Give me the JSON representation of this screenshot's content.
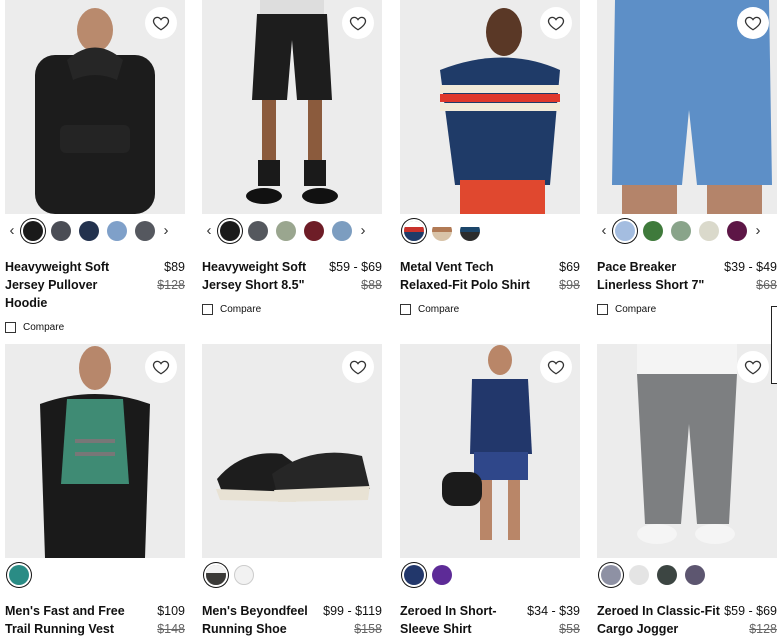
{
  "compare_label": "Compare",
  "colors": {
    "heart": "#333333",
    "text": "#111111",
    "strike": "#666666"
  },
  "products": [
    {
      "name": "Heavyweight Soft Jersey Pullover Hoodie",
      "price": "$89",
      "was": "$128",
      "swatches": [
        "#1a1a1a",
        "#4a4d55",
        "#23324e",
        "#7fa0c9",
        "#55585f"
      ],
      "has_arrows": true
    },
    {
      "name": "Heavyweight Soft Jersey Short 8.5\"",
      "price": "$59 - $69",
      "was": "$88",
      "swatches": [
        "#1a1a1a",
        "#55585e",
        "#9aa68f",
        "#6e1d27",
        "#7c9dc0"
      ],
      "has_arrows": true
    },
    {
      "name": "Metal Vent Tech Relaxed-Fit Polo Shirt",
      "price": "$69",
      "was": "$98",
      "swatches": [
        "#1f3b68",
        "#d8c3a8",
        "#1c466a"
      ],
      "has_arrows": false
    },
    {
      "name": "Pace Breaker Linerless Short 7\"",
      "price": "$39 - $49",
      "was": "$68",
      "swatches": [
        "#a4bde0",
        "#3f7a3b",
        "#89a48a",
        "#dad9cb",
        "#5d1646"
      ],
      "has_arrows": true
    },
    {
      "name": "Men's Fast and Free Trail Running Vest",
      "price": "$109",
      "was": "$148",
      "swatches": [
        "#2a8c85"
      ],
      "has_arrows": false
    },
    {
      "name": "Men's Beyondfeel Running Shoe",
      "price": "$99 - $119",
      "was": "$158",
      "swatches": [
        "#3b3a38",
        "#f2f2f2"
      ],
      "has_arrows": false
    },
    {
      "name": "Zeroed In Short-Sleeve Shirt",
      "price": "$34 - $39",
      "was": "$58",
      "swatches": [
        "#22376b",
        "#5d2b97"
      ],
      "has_arrows": false
    },
    {
      "name": "Zeroed In Classic-Fit Cargo Jogger",
      "price": "$59 - $69",
      "was": "$128",
      "swatches": [
        "#8e91a4",
        "#e4e4e4",
        "#3c4542",
        "#5d5670"
      ],
      "has_arrows": false
    }
  ]
}
